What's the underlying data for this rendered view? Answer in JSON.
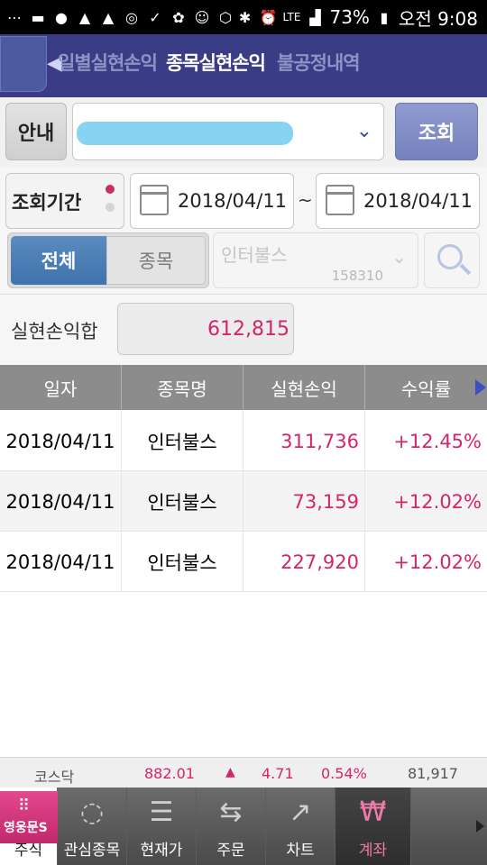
{
  "status_bar": {
    "battery": "73%",
    "time": "오전 9:08",
    "network": "LTE"
  },
  "header": {
    "tabs": [
      {
        "label": "일별실현손익"
      },
      {
        "label": "종목실현손익"
      },
      {
        "label": "불공정내역"
      }
    ]
  },
  "account_row": {
    "guide_label": "안내",
    "account_value": "",
    "query_label": "조회"
  },
  "period_row": {
    "label": "조회기간",
    "start_date": "2018/04/11",
    "separator": "~",
    "end_date": "2018/04/11"
  },
  "filter_row": {
    "seg_all": "전체",
    "seg_stock": "종목",
    "stock_name_placeholder": "인터불스",
    "stock_code": "158310"
  },
  "total_row": {
    "label": "실현손익합",
    "value": "612,815"
  },
  "table": {
    "headers": [
      "일자",
      "종목명",
      "실현손익",
      "수익률"
    ],
    "rows": [
      {
        "date": "2018/04/11",
        "name": "인터불스",
        "pnl": "311,736",
        "rate": "+12.45%"
      },
      {
        "date": "2018/04/11",
        "name": "인터불스",
        "pnl": "73,159",
        "rate": "+12.02%"
      },
      {
        "date": "2018/04/11",
        "name": "인터불스",
        "pnl": "227,920",
        "rate": "+12.02%"
      }
    ]
  },
  "ticker": {
    "index_name": "코스닥",
    "index_value": "882.01",
    "change": "4.71",
    "change_pct": "0.54%",
    "volume": "81,917"
  },
  "bottom_nav": {
    "items": [
      {
        "label": "주식",
        "icon": "grid-icon",
        "logo_text": "영웅문S"
      },
      {
        "label": "관심종목",
        "icon": "refresh-circle-icon"
      },
      {
        "label": "현재가",
        "icon": "price-bars-icon"
      },
      {
        "label": "주문",
        "icon": "swap-arrows-icon"
      },
      {
        "label": "차트",
        "icon": "chart-icon"
      },
      {
        "label": "계좌",
        "icon": "won-icon"
      }
    ]
  },
  "colors": {
    "header": "#3a3d86",
    "accent_pink": "#d6246a",
    "accent_blue": "#3f73ab"
  }
}
